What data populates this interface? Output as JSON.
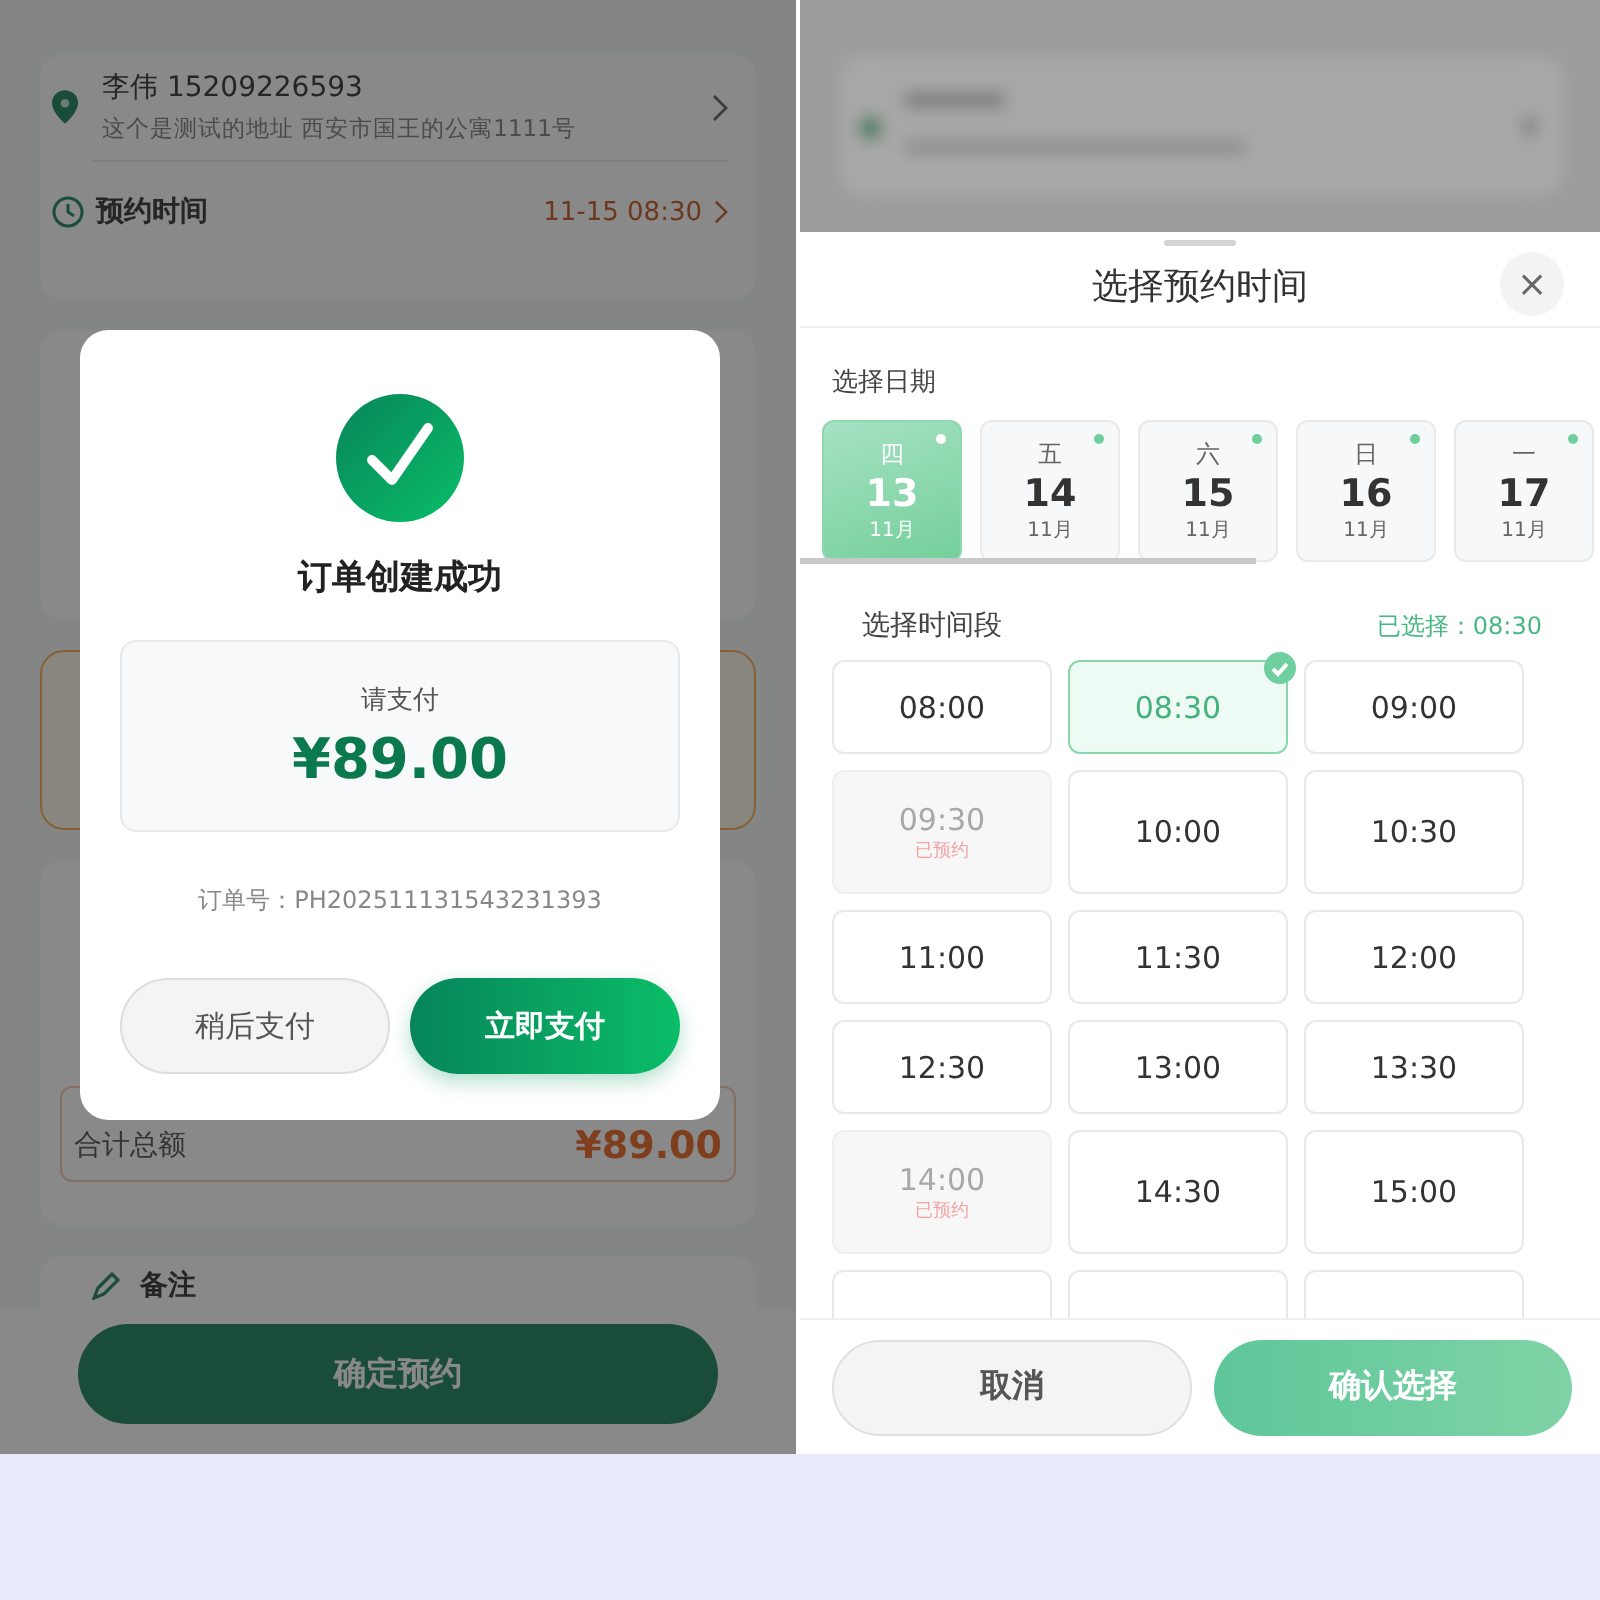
{
  "order_page": {
    "contact": "李伟 15209226593",
    "address": "这个是测试的地址 西安市国王的公寓1111号",
    "appointment": {
      "label": "预约时间",
      "value": "11-15 08:30"
    },
    "total": {
      "label": "合计总额",
      "amount": "¥89.00"
    },
    "remark": {
      "label": "备注"
    },
    "confirm_button": "确定预约"
  },
  "success_dialog": {
    "title": "订单创建成功",
    "pay_label": "请支付",
    "amount": "¥89.00",
    "order_no": "订单号：PH202511131543231393",
    "buttons": [
      {
        "label": "稍后支付",
        "kind": "secondary"
      },
      {
        "label": "立即支付",
        "kind": "primary"
      }
    ]
  },
  "time_sheet": {
    "title": "选择预约时间",
    "close": "×",
    "date_label": "选择日期",
    "dates": [
      {
        "weekday": "四",
        "day": "13",
        "month": "11月",
        "selected": true
      },
      {
        "weekday": "五",
        "day": "14",
        "month": "11月",
        "selected": false
      },
      {
        "weekday": "六",
        "day": "15",
        "month": "11月",
        "selected": false
      },
      {
        "weekday": "日",
        "day": "16",
        "month": "11月",
        "selected": false
      },
      {
        "weekday": "一",
        "day": "17",
        "month": "11月",
        "selected": false
      }
    ],
    "slot_label": "选择时间段",
    "selected_text": "已选择：08:30",
    "slots": [
      {
        "time": "08:00",
        "selected": false,
        "disabled": false
      },
      {
        "time": "08:30",
        "selected": true,
        "disabled": false
      },
      {
        "time": "09:00",
        "selected": false,
        "disabled": false
      },
      {
        "time": "09:30",
        "selected": false,
        "disabled": true,
        "note": "已预约"
      },
      {
        "time": "10:00",
        "selected": false,
        "disabled": false
      },
      {
        "time": "10:30",
        "selected": false,
        "disabled": false
      },
      {
        "time": "11:00",
        "selected": false,
        "disabled": false
      },
      {
        "time": "11:30",
        "selected": false,
        "disabled": false
      },
      {
        "time": "12:00",
        "selected": false,
        "disabled": false
      },
      {
        "time": "12:30",
        "selected": false,
        "disabled": false
      },
      {
        "time": "13:00",
        "selected": false,
        "disabled": false
      },
      {
        "time": "13:30",
        "selected": false,
        "disabled": false
      },
      {
        "time": "14:00",
        "selected": false,
        "disabled": true,
        "note": "已预约"
      },
      {
        "time": "14:30",
        "selected": false,
        "disabled": false
      },
      {
        "time": "15:00",
        "selected": false,
        "disabled": false
      }
    ],
    "buttons": [
      {
        "label": "取消",
        "kind": "secondary"
      },
      {
        "label": "确认选择",
        "kind": "primary"
      }
    ]
  }
}
